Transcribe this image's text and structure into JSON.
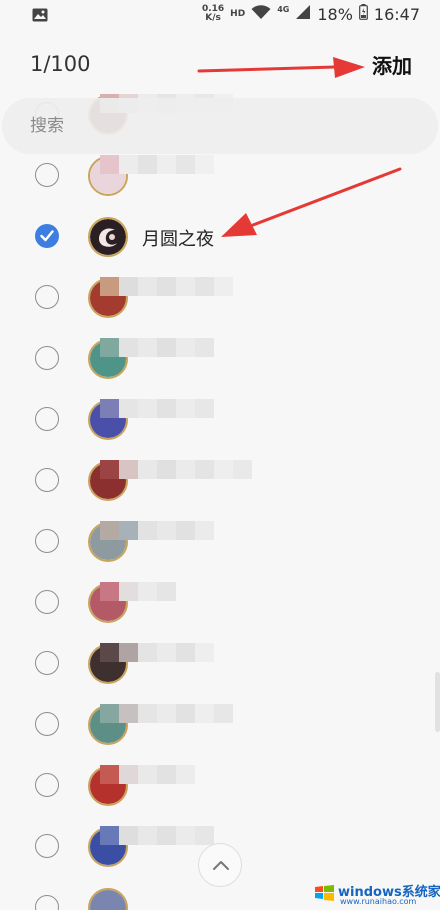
{
  "status_bar": {
    "speed_value": "0.16",
    "speed_unit": "K/s",
    "hd": "HD",
    "network": "4G",
    "battery": "18%",
    "time": "16:47"
  },
  "header": {
    "counter": "1/100",
    "add_label": "添加"
  },
  "search": {
    "placeholder": "搜索"
  },
  "contacts": [
    {
      "name": "",
      "selected": false
    },
    {
      "name": "",
      "selected": false
    },
    {
      "name": "月圆之夜",
      "selected": true
    },
    {
      "name": "",
      "selected": false
    },
    {
      "name": "",
      "selected": false
    },
    {
      "name": "",
      "selected": false
    },
    {
      "name": "",
      "selected": false
    },
    {
      "name": "",
      "selected": false
    },
    {
      "name": "",
      "selected": false
    },
    {
      "name": "",
      "selected": false
    },
    {
      "name": "",
      "selected": false
    },
    {
      "name": "",
      "selected": false
    },
    {
      "name": "",
      "selected": false
    }
  ],
  "watermark": {
    "title": "windows系统家园",
    "subtitle": "www.runaihao.com"
  },
  "colors": {
    "accent": "#3e7ee0",
    "arrow": "#e53935",
    "background": "#f7f7f7"
  }
}
